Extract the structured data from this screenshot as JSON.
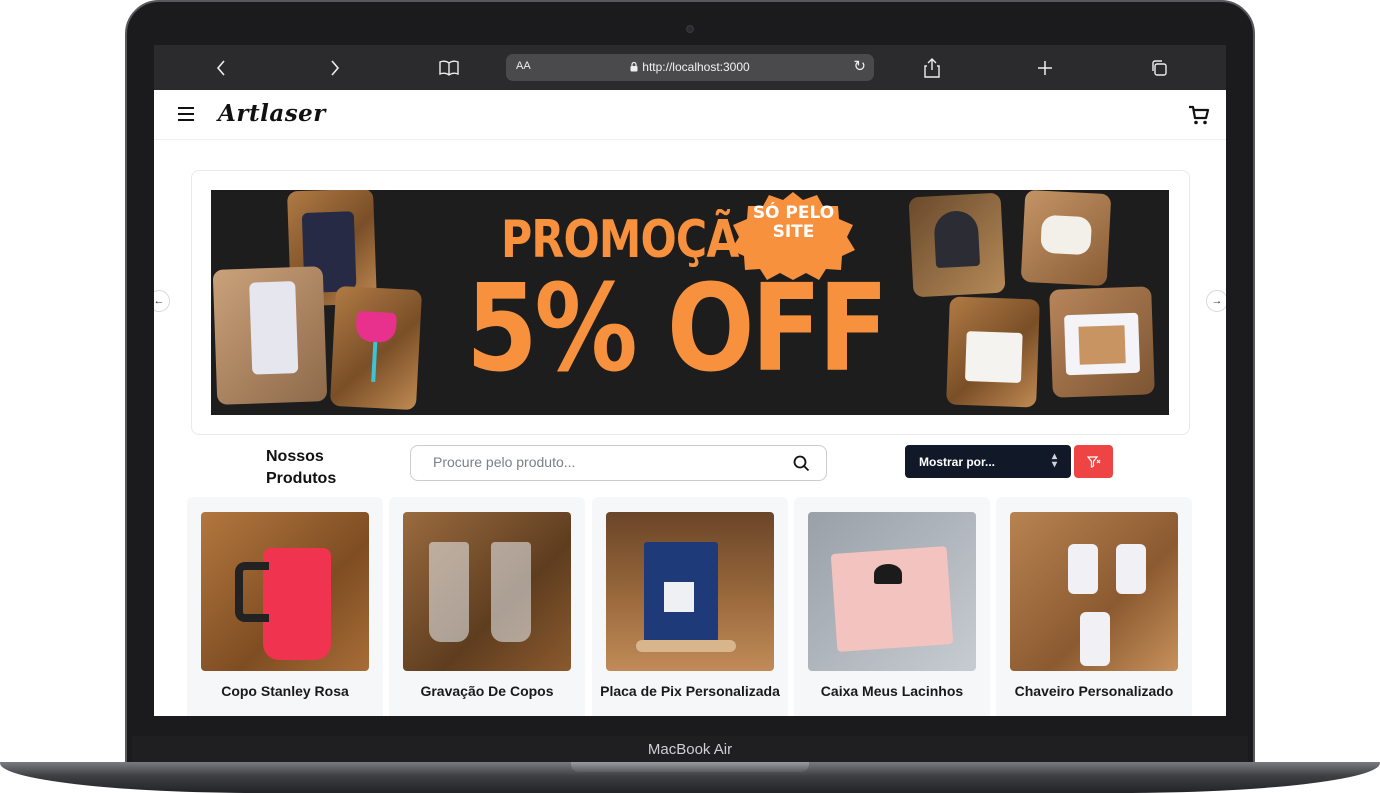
{
  "device": {
    "label": "MacBook Air"
  },
  "browser": {
    "back_icon": "chevron-left-icon",
    "forward_icon": "chevron-right-icon",
    "text_size_label": "AA",
    "url": "http://localhost:3000"
  },
  "header": {
    "logo": "Artlaser"
  },
  "banner": {
    "headline": "PROMOÇÃO",
    "badge": "SÓ PELO SITE",
    "offer": "5% OFF"
  },
  "products": {
    "title": "Nossos Produtos",
    "search_placeholder": "Procure pelo produto...",
    "sort_label": "Mostrar por...",
    "items": [
      {
        "name": "Copo Stanley Rosa"
      },
      {
        "name": "Gravação De Copos"
      },
      {
        "name": "Placa de Pix Personalizada"
      },
      {
        "name": "Caixa Meus Lacinhos"
      },
      {
        "name": "Chaveiro Personalizado"
      }
    ]
  },
  "colors": {
    "accent": "#ef4444",
    "dark": "#111827",
    "promo": "#f7913d"
  }
}
